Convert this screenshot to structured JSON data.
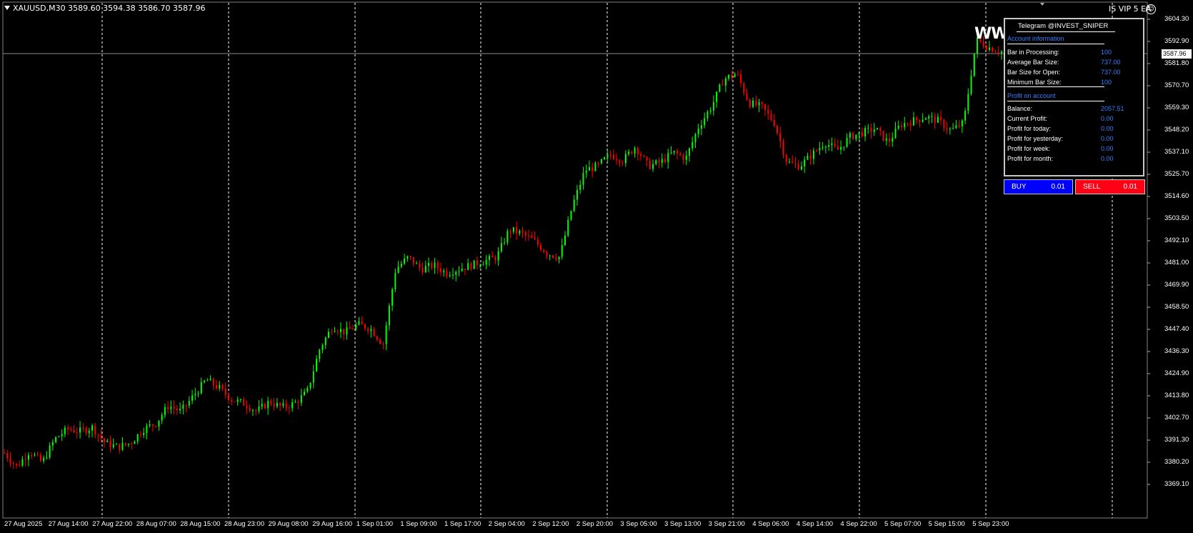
{
  "symbol_info": "XAUUSD,M30  3589.60 3594.38 3586.70 3587.96",
  "ea_name": "IS VIP 5 EA",
  "overlay_text": "WW",
  "current_price": "3587.96",
  "panel": {
    "title": "Telegram @INVEST_SNIPER",
    "section_account": "Account information",
    "rows_account": [
      {
        "label": "Bar in Processing:",
        "value": "100"
      },
      {
        "label": "Average Bar Size:",
        "value": "737.00"
      },
      {
        "label": "Bar Size for Open:",
        "value": "737.00"
      },
      {
        "label": "Minimum Bar Size:",
        "value": "100"
      }
    ],
    "section_profit": "Profit on account",
    "rows_profit": [
      {
        "label": "Balance:",
        "value": "2057.51"
      },
      {
        "label": "Current Profit:",
        "value": "0.00"
      },
      {
        "label": "Profit for today:",
        "value": "0.00"
      },
      {
        "label": "Profit for yesterday:",
        "value": "0.00"
      },
      {
        "label": "Profit for week:",
        "value": "0.00"
      },
      {
        "label": "Profit for month:",
        "value": "0.00"
      }
    ]
  },
  "buy_button": {
    "label": "BUY",
    "lot": "0.01"
  },
  "sell_button": {
    "label": "SELL",
    "lot": "0.01"
  },
  "y_axis_labels": [
    "3604.30",
    "3592.90",
    "3581.80",
    "3570.70",
    "3559.30",
    "3548.20",
    "3537.10",
    "3525.70",
    "3514.60",
    "3503.50",
    "3492.10",
    "3481.00",
    "3469.90",
    "3458.50",
    "3447.40",
    "3436.30",
    "3424.90",
    "3413.80",
    "3402.70",
    "3391.30",
    "3380.20",
    "3369.10"
  ],
  "x_axis_labels": [
    "27 Aug 2025",
    "27 Aug 14:00",
    "27 Aug 22:00",
    "28 Aug 07:00",
    "28 Aug 15:00",
    "28 Aug 23:00",
    "29 Aug 08:00",
    "29 Aug 16:00",
    "1 Sep 01:00",
    "1 Sep 09:00",
    "1 Sep 17:00",
    "2 Sep 04:00",
    "2 Sep 12:00",
    "2 Sep 20:00",
    "3 Sep 05:00",
    "3 Sep 13:00",
    "3 Sep 21:00",
    "4 Sep 06:00",
    "4 Sep 14:00",
    "4 Sep 22:00",
    "5 Sep 07:00",
    "5 Sep 15:00",
    "5 Sep 23:00"
  ],
  "colors": {
    "background": "#000000",
    "bull": "#00ff00",
    "bear": "#ff0000",
    "grid": "#ffffff",
    "buy": "#0000ff",
    "sell": "#ff0014"
  },
  "price_path": [
    3385,
    3378,
    3386,
    3380,
    3392,
    3397,
    3396,
    3398,
    3390,
    3388,
    3390,
    3397,
    3400,
    3409,
    3406,
    3414,
    3422,
    3418,
    3412,
    3410,
    3406,
    3411,
    3408,
    3410,
    3416,
    3438,
    3449,
    3446,
    3450,
    3448,
    3440,
    3478,
    3484,
    3478,
    3480,
    3476,
    3478,
    3480,
    3482,
    3484,
    3498,
    3496,
    3492,
    3486,
    3484,
    3510,
    3528,
    3530,
    3536,
    3533,
    3540,
    3530,
    3532,
    3537,
    3534,
    3550,
    3560,
    3574,
    3577,
    3562,
    3560,
    3552,
    3532,
    3530,
    3536,
    3542,
    3538,
    3545,
    3547,
    3549,
    3542,
    3551,
    3553,
    3555,
    3553,
    3548,
    3552,
    3594,
    3590,
    3588
  ]
}
